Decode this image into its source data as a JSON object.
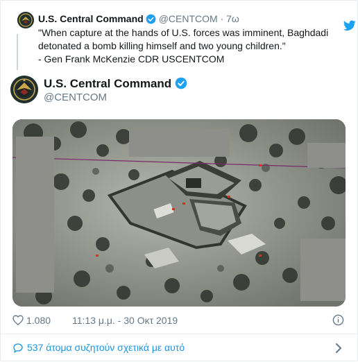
{
  "quoted_tweet": {
    "name": "U.S. Central Command",
    "handle": "@CENTCOM",
    "separator": "·",
    "time": "7ω",
    "text": "\"When capture at the hands of U.S. forces was imminent, Baghdadi detonated a bomb killing himself and two young children.\"\n- Gen Frank McKenzie CDR USCENTCOM"
  },
  "tweet": {
    "name": "U.S. Central Command",
    "handle": "@CENTCOM"
  },
  "meta": {
    "likes": "1.080",
    "timestamp": "11:13 μ.μ. - 30 Οκτ 2019"
  },
  "conversation": {
    "label": "537 άτομα συζητούν σχετικά με αυτό"
  },
  "icons": {
    "verified": "verified-badge-icon",
    "bird": "twitter-bird-icon",
    "heart": "heart-icon",
    "info": "info-icon",
    "reply": "speech-bubble-icon",
    "chevron": "chevron-right-icon"
  },
  "colors": {
    "accent": "#1da1f2",
    "link": "#1b95e0",
    "muted": "#657786",
    "text": "#14171a"
  }
}
